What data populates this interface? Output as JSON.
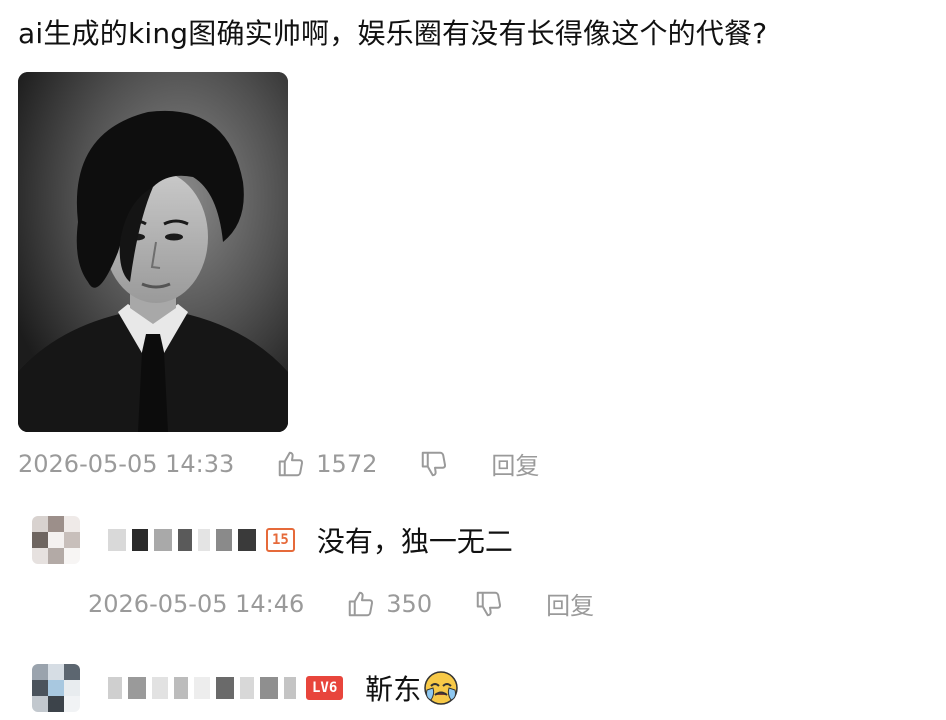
{
  "post": {
    "text": "ai生成的king图确实帅啊，娱乐圈有没有长得像这个的代餐?",
    "time": "2026-05-05 14:33",
    "likes": "1572",
    "reply_label": "回复"
  },
  "comments": [
    {
      "level": "15",
      "text": "没有，独一无二",
      "time": "2026-05-05 14:46",
      "likes": "350",
      "reply_label": "回复"
    },
    {
      "level": "LV6",
      "text": "靳东",
      "emoji": "crying-face-emoji"
    }
  ],
  "colors": {
    "meta_text": "#9a9a9a",
    "level_orange": "#e66a3a",
    "level_red": "#e8453c"
  }
}
